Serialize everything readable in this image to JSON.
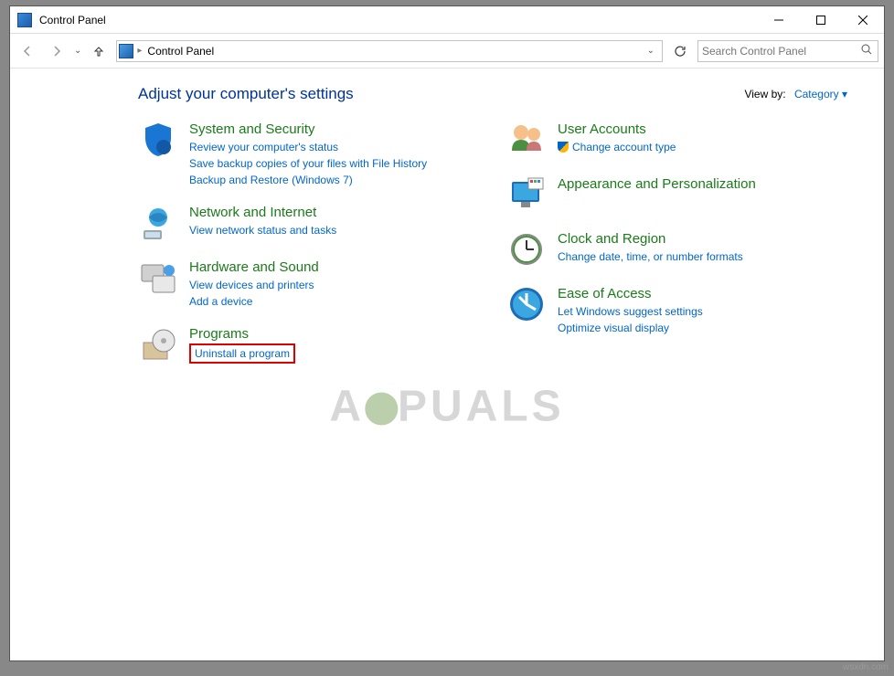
{
  "window": {
    "title": "Control Panel"
  },
  "nav": {
    "breadcrumb": "Control Panel",
    "search_placeholder": "Search Control Panel"
  },
  "header": {
    "adjust": "Adjust your computer's settings",
    "viewby_label": "View by:",
    "viewby_value": "Category"
  },
  "left": {
    "security": {
      "title": "System and Security",
      "l1": "Review your computer's status",
      "l2": "Save backup copies of your files with File History",
      "l3": "Backup and Restore (Windows 7)"
    },
    "network": {
      "title": "Network and Internet",
      "l1": "View network status and tasks"
    },
    "hardware": {
      "title": "Hardware and Sound",
      "l1": "View devices and printers",
      "l2": "Add a device"
    },
    "programs": {
      "title": "Programs",
      "l1": "Uninstall a program"
    }
  },
  "right": {
    "user": {
      "title": "User Accounts",
      "l1": "Change account type"
    },
    "appearance": {
      "title": "Appearance and Personalization"
    },
    "clock": {
      "title": "Clock and Region",
      "l1": "Change date, time, or number formats"
    },
    "ease": {
      "title": "Ease of Access",
      "l1": "Let Windows suggest settings",
      "l2": "Optimize visual display"
    }
  },
  "watermark": {
    "a": "A",
    "puals": "PUALS"
  },
  "source": "wsxdn.com"
}
